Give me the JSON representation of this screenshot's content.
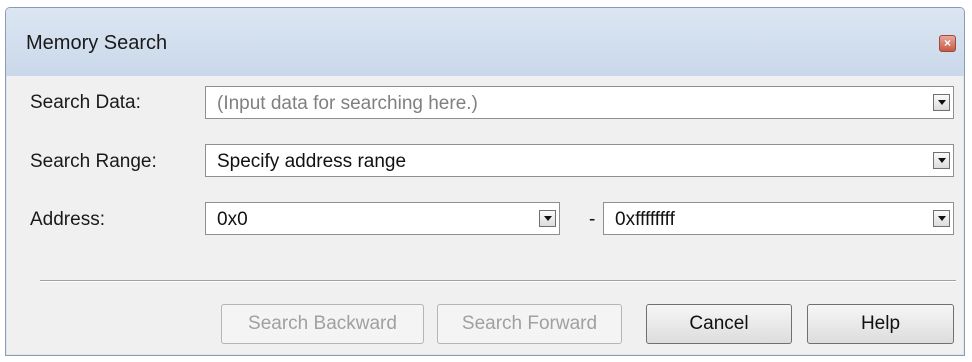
{
  "window": {
    "title": "Memory Search",
    "close_glyph": "×"
  },
  "fields": {
    "search_data": {
      "label": "Search Data:",
      "placeholder": "(Input data for searching here.)"
    },
    "search_range": {
      "label": "Search Range:",
      "value": "Specify address range"
    },
    "address": {
      "label": "Address:",
      "start": "0x0",
      "separator": "-",
      "end": "0xffffffff"
    }
  },
  "buttons": {
    "search_backward": "Search Backward",
    "search_forward": "Search Forward",
    "cancel": "Cancel",
    "help": "Help"
  },
  "state": {
    "search_backward_enabled": false,
    "search_forward_enabled": false
  },
  "icons": {
    "close": "close-icon",
    "dropdown": "chevron-down-icon"
  },
  "colors": {
    "titlebar": "#d4e0ee",
    "close_button": "#d06a57",
    "dialog_background": "#f0f0f0"
  }
}
